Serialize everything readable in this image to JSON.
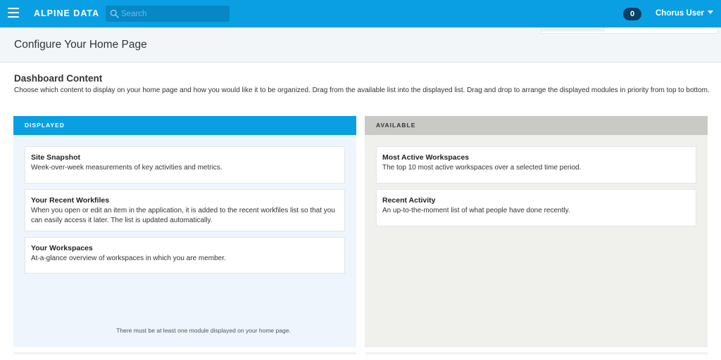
{
  "topbar": {
    "brand": "ALPINE DATA",
    "search_placeholder": "Search",
    "notifications_count": "0",
    "user_name": "Chorus User",
    "color": "#0a9fe3"
  },
  "page": {
    "title": "Configure Your Home Page"
  },
  "section": {
    "title": "Dashboard Content",
    "description": "Choose which content to display on your home page and how you would like it to be organized. Drag from the available list into the displayed list. Drag and drop to arrange the displayed modules in priority from top to bottom."
  },
  "displayed": {
    "header": "DISPLAYED",
    "note": "There must be at least one module displayed on your home page.",
    "items": [
      {
        "title": "Site Snapshot",
        "description": "Week-over-week measurements of key activities and metrics."
      },
      {
        "title": "Your Recent Workfiles",
        "description": "When you open or edit an item in the application, it is added to the recent workfiles list so that you can easily access it later. The list is updated automatically."
      },
      {
        "title": "Your Workspaces",
        "description": "At-a-glance overview of workspaces in which you are member."
      }
    ]
  },
  "available": {
    "header": "AVAILABLE",
    "items": [
      {
        "title": "Most Active Workspaces",
        "description": "The top 10 most active workspaces over a selected time period."
      },
      {
        "title": "Recent Activity",
        "description": "An up-to-the-moment list of what people have done recently."
      }
    ]
  }
}
